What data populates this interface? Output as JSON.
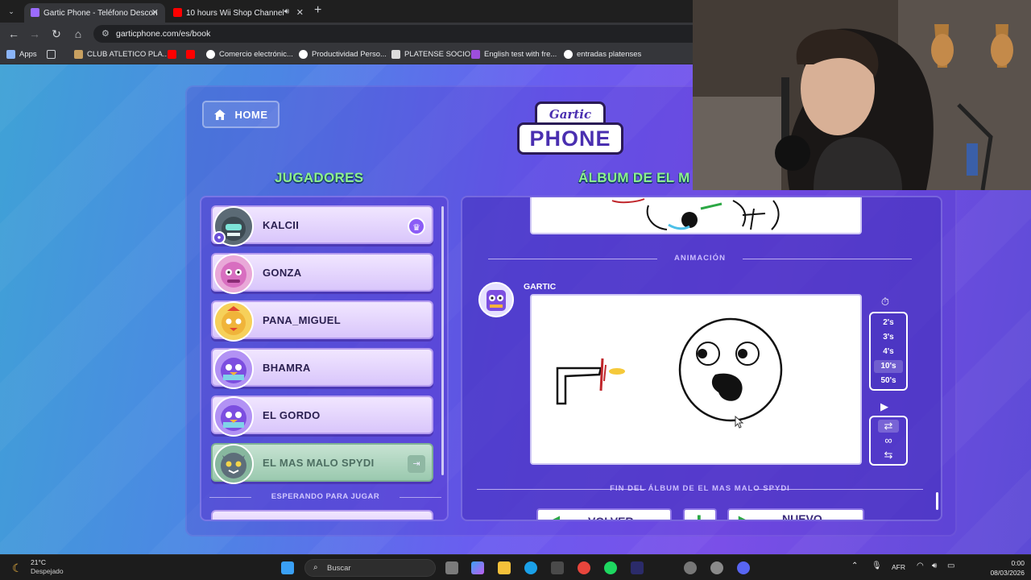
{
  "browser": {
    "tabs": [
      {
        "title": "Gartic Phone - Teléfono Descon",
        "active": true
      },
      {
        "title": "10 hours Wii Shop Channel",
        "active": false
      }
    ],
    "url": "garticphone.com/es/book",
    "bookmarks": [
      "Apps",
      "CLUB ATLETICO PLA...",
      "Comercio electrónic...",
      "Productividad Perso...",
      "PLATENSE SOCIO",
      "English test with fre...",
      "entradas platenses"
    ]
  },
  "page": {
    "home_label": "HOME",
    "logo_top": "Gartic",
    "logo_bottom": "PHONE",
    "players_title": "JUGADORES",
    "album_title": "ÁLBUM DE EL M",
    "players": [
      {
        "name": "KALCII",
        "badge": "crown-icon"
      },
      {
        "name": "GONZA"
      },
      {
        "name": "PANA_MIGUEL"
      },
      {
        "name": "BHAMRA"
      },
      {
        "name": "EL GORDO"
      },
      {
        "name": "EL MAS MALO SPYDI",
        "self": true
      }
    ],
    "waiting_label": "ESPERANDO PARA JUGAR",
    "animation_label": "ANIMACIÓN",
    "author": "GARTIC",
    "speeds": [
      "2's",
      "3's",
      "4's",
      "10's",
      "50's"
    ],
    "selected_speed": "10's",
    "end_label": "FIN DEL ÁLBUM DE EL MAS MALO SPYDI",
    "buttons": {
      "back": "VOLVER",
      "new": "NUEVO"
    }
  },
  "taskbar": {
    "temperature": "21°C",
    "weather": "Despejado",
    "search_placeholder": "Buscar",
    "language": "AFR",
    "time": "0:00",
    "date": "08/03/2026"
  },
  "colors": {
    "accent_green": "#8ef28e",
    "panel_purple": "#5a3cd2",
    "player_card": "#e4d6fd"
  }
}
